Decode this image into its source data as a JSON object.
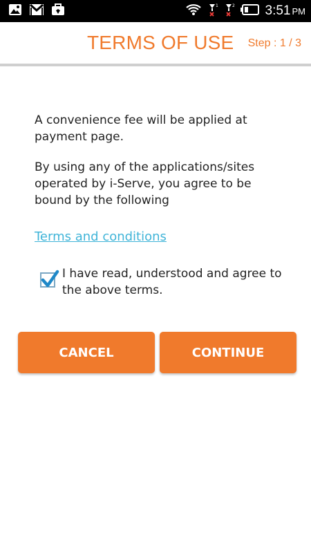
{
  "status_bar": {
    "time": "3:51",
    "ampm": "PM",
    "icons_left": [
      "image-icon",
      "gmail-icon",
      "briefcase-icon"
    ],
    "icons_right": [
      "wifi-icon",
      "signal-x-icon",
      "signal-x-icon",
      "battery-icon"
    ]
  },
  "header": {
    "title": "TERMS OF USE",
    "step": "Step : 1 / 3"
  },
  "content": {
    "fee_notice": "A convenience fee will be applied at payment page.",
    "agreement_notice": "By using any of the applications/sites operated by i-Serve, you agree to be bound by the following",
    "terms_link": "Terms and conditions",
    "agree_label": "I have read, understood and agree to the above terms."
  },
  "buttons": {
    "cancel": "CANCEL",
    "continue": "CONTINUE"
  },
  "colors": {
    "accent": "#f07a2c",
    "link": "#3fb4d8",
    "check": "#1e88c8"
  }
}
